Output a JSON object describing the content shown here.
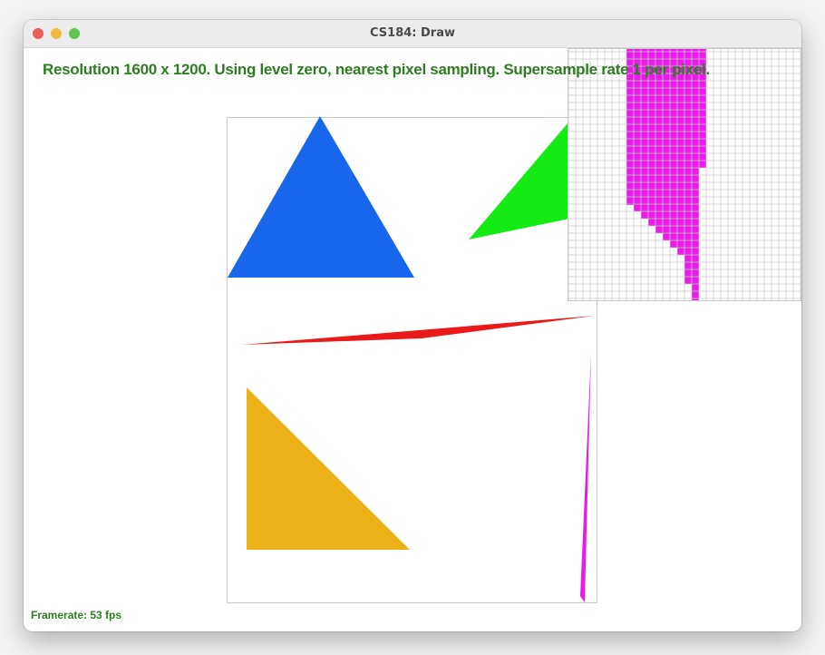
{
  "window": {
    "title": "CS184: Draw",
    "controls": [
      {
        "name": "close",
        "color": "#ec5f57"
      },
      {
        "name": "minimize",
        "color": "#f0bc3e"
      },
      {
        "name": "zoom",
        "color": "#5fc453"
      }
    ]
  },
  "overlay": {
    "status_text": "Resolution 1600 x 1200. Using level zero, nearest pixel sampling. Supersample rate 1 per pixel.",
    "framerate_text": "Framerate: 53 fps",
    "text_color": "#2e7d22"
  },
  "scene": {
    "triangles": [
      {
        "name": "blue-triangle",
        "color": "#1766ec"
      },
      {
        "name": "green-triangle",
        "color": "#14ea14"
      },
      {
        "name": "red-sliver-triangle",
        "color": "#ea1a1a"
      },
      {
        "name": "yellow-triangle",
        "color": "#ecb21a"
      },
      {
        "name": "magenta-sliver-triangle",
        "color": "#e81be8"
      }
    ],
    "frame_color": "#c8c8c8"
  },
  "zoom_inspector": {
    "fill_color": "#e81be8",
    "grid_color": "#c8c8c8"
  }
}
